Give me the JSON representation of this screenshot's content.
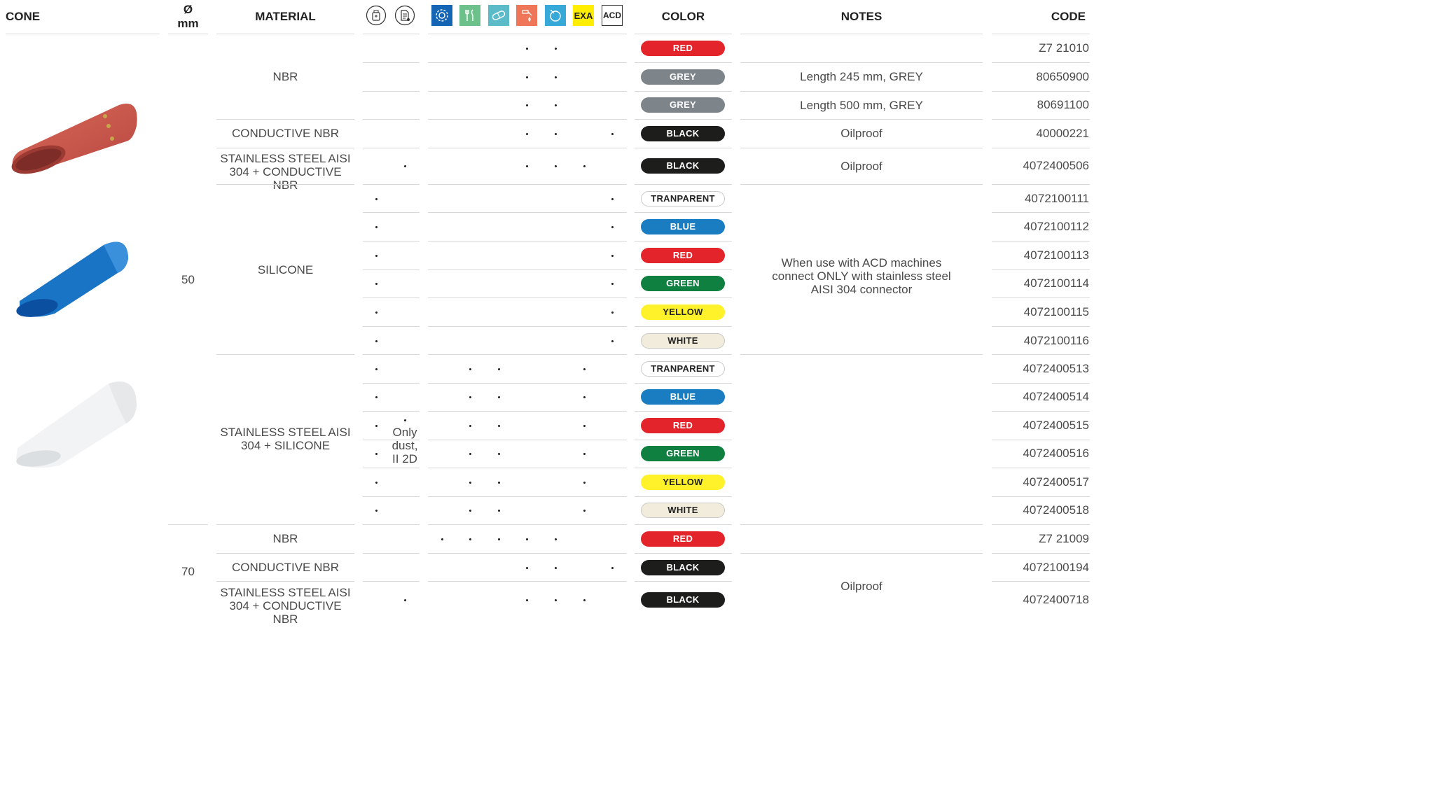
{
  "headers": {
    "cone": "CONE",
    "diameter_symbol": "Ø",
    "diameter_unit": "mm",
    "material": "MATERIAL",
    "color": "COLOR",
    "notes": "NOTES",
    "code": "CODE"
  },
  "icons": {
    "atex_gas": "atex-gas-icon",
    "atex_dust": "atex-dust-icon",
    "industry": "gear-icon",
    "food": "cutlery-icon",
    "pharma": "pill-icon",
    "oil": "oil-drop-icon",
    "cleaning": "cleaning-icon",
    "exa_label": "EXA",
    "acd_label": "ACD",
    "colors": {
      "industry": "#1565b5",
      "food": "#6cc08a",
      "pharma": "#5bbbc9",
      "oil": "#ef7658",
      "cleaning": "#37a9d9",
      "exa": "#ffee00"
    }
  },
  "diameters": [
    "50",
    "70"
  ],
  "materials": {
    "nbr": "NBR",
    "conductive_nbr": "CONDUCTIVE NBR",
    "ss_conductive_nbr": "STAINLESS STEEL AISI 304 + CONDUCTIVE NBR",
    "silicone": "SILICONE",
    "ss_silicone": "STAINLESS STEEL AISI 304 + SILICONE",
    "nbr_70": "NBR",
    "conductive_nbr_70": "CONDUCTIVE NBR",
    "ss_conductive_nbr_70": "STAINLESS STEEL AISI 304 + CONDUCTIVE NBR"
  },
  "dust_note": {
    "line1": "Only",
    "line2": "dust,",
    "line3": "II 2D"
  },
  "notes": {
    "grey_245": "Length 245 mm, GREY",
    "grey_500": "Length 500 mm, GREY",
    "oilproof_1": "Oilproof",
    "oilproof_2": "Oilproof",
    "acd": "When use with ACD machines connect ONLY with stainless steel AISI 304 connector",
    "oilproof_3": "Oilproof"
  },
  "rows": [
    {
      "color": "RED",
      "code": "Z7 21010"
    },
    {
      "color": "GREY",
      "code": "80650900"
    },
    {
      "color": "GREY",
      "code": "80691100"
    },
    {
      "color": "BLACK",
      "code": "40000221"
    },
    {
      "color": "BLACK",
      "code": "4072400506"
    },
    {
      "color": "TRANPARENT",
      "code": "4072100111"
    },
    {
      "color": "BLUE",
      "code": "4072100112"
    },
    {
      "color": "RED",
      "code": "4072100113"
    },
    {
      "color": "GREEN",
      "code": "4072100114"
    },
    {
      "color": "YELLOW",
      "code": "4072100115"
    },
    {
      "color": "WHITE",
      "code": "4072100116"
    },
    {
      "color": "TRANPARENT",
      "code": "4072400513"
    },
    {
      "color": "BLUE",
      "code": "4072400514"
    },
    {
      "color": "RED",
      "code": "4072400515"
    },
    {
      "color": "GREEN",
      "code": "4072400516"
    },
    {
      "color": "YELLOW",
      "code": "4072400517"
    },
    {
      "color": "WHITE",
      "code": "4072400518"
    },
    {
      "color": "RED",
      "code": "Z7 21009"
    },
    {
      "color": "BLACK",
      "code": "4072100194"
    },
    {
      "color": "BLACK",
      "code": "4072400718"
    }
  ],
  "pill_colors": {
    "RED": {
      "bg": "#e3242b",
      "fg": "#ffffff"
    },
    "GREY": {
      "bg": "#7d858b",
      "fg": "#ffffff"
    },
    "BLACK": {
      "bg": "#1d1d1b",
      "fg": "#ffffff"
    },
    "TRANPARENT": {
      "bg": "#ffffff",
      "fg": "#222222"
    },
    "BLUE": {
      "bg": "#1a7cc1",
      "fg": "#ffffff"
    },
    "GREEN": {
      "bg": "#108040",
      "fg": "#ffffff"
    },
    "YELLOW": {
      "bg": "#fff22a",
      "fg": "#222222"
    },
    "WHITE": {
      "bg": "#f1ecdc",
      "fg": "#222222"
    }
  }
}
